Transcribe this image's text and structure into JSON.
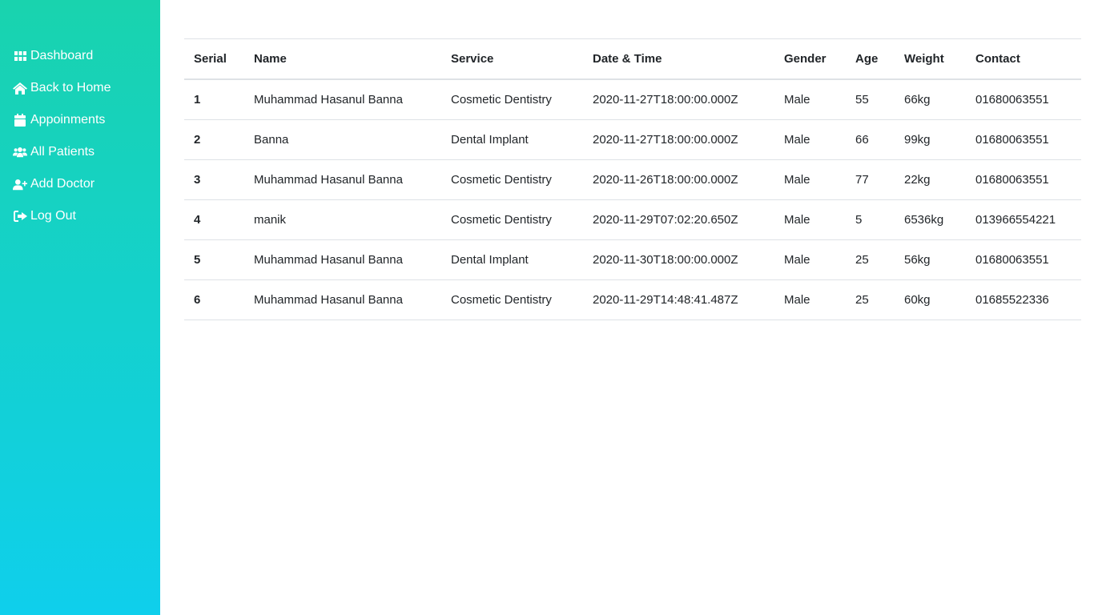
{
  "sidebar": {
    "items": [
      {
        "label": "Dashboard",
        "icon": "grid-icon"
      },
      {
        "label": "Back to Home",
        "icon": "home-icon"
      },
      {
        "label": "Appoinments",
        "icon": "calendar-icon"
      },
      {
        "label": "All Patients",
        "icon": "users-icon"
      },
      {
        "label": "Add Doctor",
        "icon": "user-plus-icon"
      },
      {
        "label": "Log Out",
        "icon": "sign-out-icon"
      }
    ],
    "gradient_top": "#19d3ae",
    "gradient_bottom": "#0fcfec"
  },
  "table": {
    "headers": [
      "Serial",
      "Name",
      "Service",
      "Date & Time",
      "Gender",
      "Age",
      "Weight",
      "Contact"
    ],
    "rows": [
      [
        "1",
        "Muhammad Hasanul Banna",
        "Cosmetic Dentistry",
        "2020-11-27T18:00:00.000Z",
        "Male",
        "55",
        "66kg",
        "01680063551"
      ],
      [
        "2",
        "Banna",
        "Dental Implant",
        "2020-11-27T18:00:00.000Z",
        "Male",
        "66",
        "99kg",
        "01680063551"
      ],
      [
        "3",
        "Muhammad Hasanul Banna",
        "Cosmetic Dentistry",
        "2020-11-26T18:00:00.000Z",
        "Male",
        "77",
        "22kg",
        "01680063551"
      ],
      [
        "4",
        "manik",
        "Cosmetic Dentistry",
        "2020-11-29T07:02:20.650Z",
        "Male",
        "5",
        "6536kg",
        "013966554221"
      ],
      [
        "5",
        "Muhammad Hasanul Banna",
        "Dental Implant",
        "2020-11-30T18:00:00.000Z",
        "Male",
        "25",
        "56kg",
        "01680063551"
      ],
      [
        "6",
        "Muhammad Hasanul Banna",
        "Cosmetic Dentistry",
        "2020-11-29T14:48:41.487Z",
        "Male",
        "25",
        "60kg",
        "01685522336"
      ]
    ]
  }
}
